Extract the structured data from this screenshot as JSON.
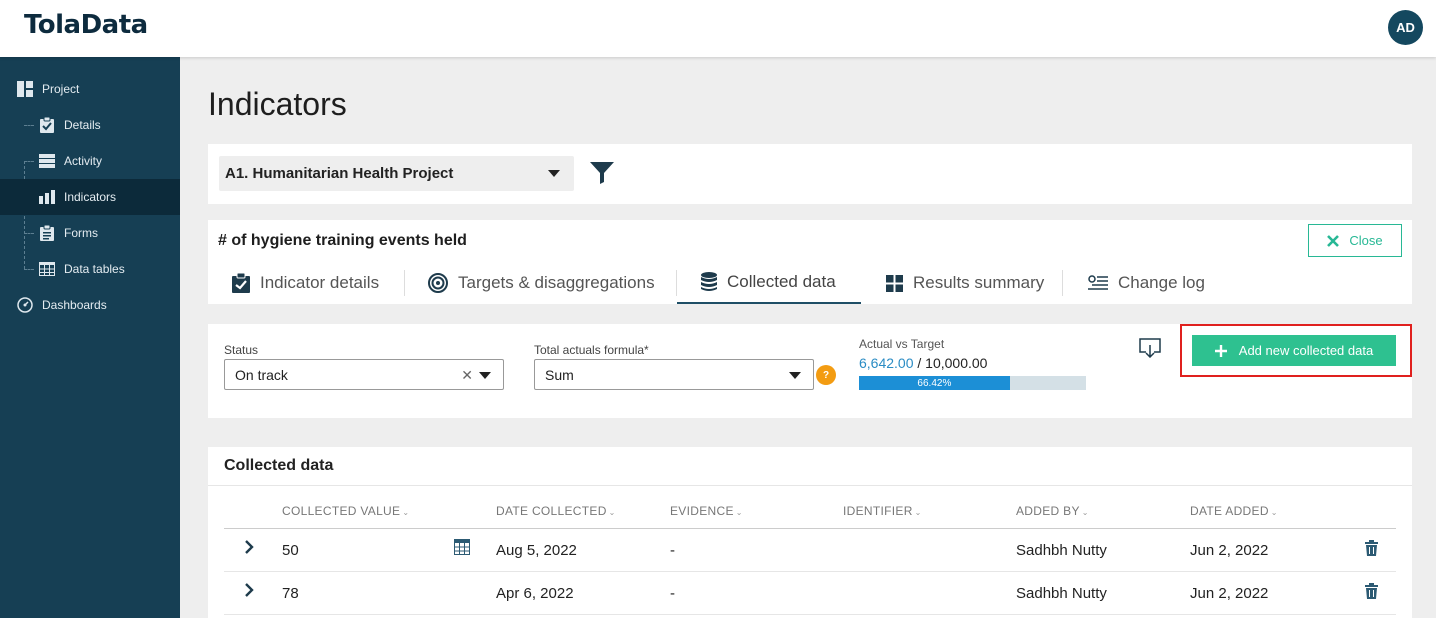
{
  "app": {
    "logo": "TolaData",
    "user_initials": "AD"
  },
  "sidebar": {
    "items": [
      {
        "label": "Project",
        "icon": "project-icon"
      },
      {
        "label": "Details",
        "icon": "clipboard-check-icon"
      },
      {
        "label": "Activity",
        "icon": "server-icon"
      },
      {
        "label": "Indicators",
        "icon": "bar-chart-icon",
        "active": true
      },
      {
        "label": "Forms",
        "icon": "clipboard-list-icon"
      },
      {
        "label": "Data tables",
        "icon": "table-icon"
      },
      {
        "label": "Dashboards",
        "icon": "gauge-icon"
      }
    ]
  },
  "page": {
    "title": "Indicators"
  },
  "filter": {
    "project": "A1. Humanitarian Health Project"
  },
  "indicator": {
    "title": "# of hygiene training events held",
    "close_label": "Close",
    "tabs": [
      {
        "label": "Indicator details",
        "icon": "clipboard-check-icon"
      },
      {
        "label": "Targets & disaggregations",
        "icon": "target-icon"
      },
      {
        "label": "Collected data",
        "icon": "database-icon",
        "active": true
      },
      {
        "label": "Results summary",
        "icon": "grid-icon"
      },
      {
        "label": "Change log",
        "icon": "log-icon"
      }
    ]
  },
  "status_panel": {
    "status_label": "Status",
    "status_value": "On track",
    "formula_label": "Total actuals formula*",
    "formula_value": "Sum",
    "help": "?",
    "avt_title": "Actual vs Target",
    "actual": "6,642.00",
    "target": "/ 10,000.00",
    "progress_label": "66.42%",
    "progress_fraction": 0.6642,
    "add_label": "Add new collected data"
  },
  "collected": {
    "title": "Collected data",
    "columns": [
      "COLLECTED VALUE",
      "DATE COLLECTED",
      "EVIDENCE",
      "IDENTIFIER",
      "ADDED BY",
      "DATE ADDED"
    ],
    "rows": [
      {
        "value": "50",
        "date_collected": "Aug 5, 2022",
        "evidence": "-",
        "identifier": "",
        "added_by": "Sadhbh Nutty",
        "date_added": "Jun 2, 2022"
      },
      {
        "value": "78",
        "date_collected": "Apr 6, 2022",
        "evidence": "-",
        "identifier": "",
        "added_by": "Sadhbh Nutty",
        "date_added": "Jun 2, 2022"
      }
    ]
  },
  "colors": {
    "sidebar": "#163f54",
    "accent": "#2ec190",
    "highlight": "#e0201e",
    "progress": "#1c8fd6"
  }
}
